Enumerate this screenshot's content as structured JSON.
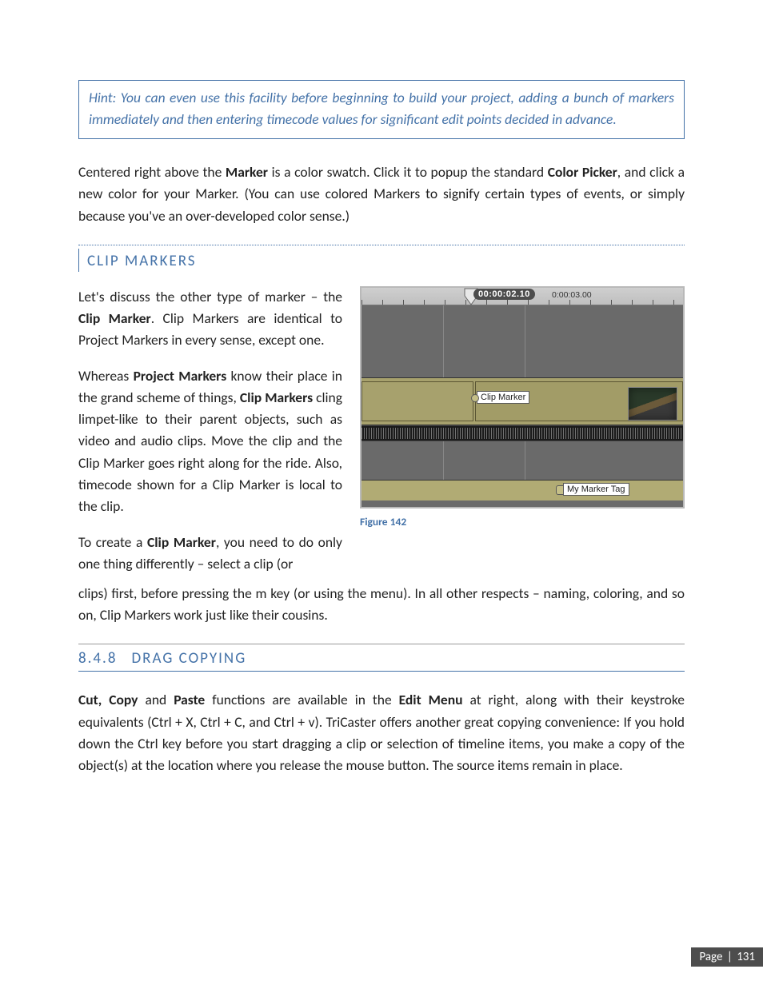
{
  "hint": "Hint: You can even use this facility before beginning to build your project, adding a bunch of markers immediately and then entering timecode values for significant edit points decided in advance.",
  "para_color": {
    "seg1": "Centered right above the ",
    "marker": "Marker",
    "seg2": " is a color swatch.  Click it to popup the standard ",
    "picker": "Color Picker",
    "seg3": ", and click a new color for your Marker.  (You can use colored Markers to signify certain types of events, or simply because you've an over-developed color sense.)"
  },
  "clip_heading": "CLIP MARKERS",
  "clip_p1": {
    "seg1": "Let's discuss the other type of marker – the ",
    "b1": "Clip Marker",
    "seg2": ". Clip Markers are identical to Project Markers in every sense, except one."
  },
  "clip_p2": {
    "seg1": "Whereas ",
    "b1": "Project Markers",
    "seg2": " know their place in the grand scheme of things, ",
    "b2": "Clip Markers",
    "seg3": " cling limpet-like to their parent objects, such as video and audio clips. Move the clip and the Clip Marker goes right along for the ride. Also, timecode shown for a Clip Marker is local to the clip."
  },
  "clip_p3": {
    "seg1": "To create a ",
    "b1": "Clip Marker",
    "seg2": ", you need to do only one thing differently – select a clip (or"
  },
  "clip_p4": "clips) first, before pressing the m key (or using the menu). In all other respects – naming, coloring, and so on, Clip Markers work just like their cousins.",
  "figure": {
    "timecode_badge": "00:00:02.10",
    "timecode_small": "0:00:03.00",
    "clip_marker_label": "Clip Marker",
    "marker_tag_label": "My Marker Tag",
    "caption": "Figure 142"
  },
  "drag": {
    "num": "8.4.8",
    "title": "DRAG COPYING",
    "para": {
      "b1": "Cut, Copy",
      "seg1": " and ",
      "b2": "Paste",
      "seg2": " functions are available in the ",
      "b3": "Edit Menu",
      "seg3": " at right, along with their keystroke equivalents (Ctrl + X, Ctrl + C, and Ctrl + v). TriCaster offers another great copying convenience: If you hold down the Ctrl key before you start dragging a clip or selection of timeline items, you make a copy of the object(s) at the location where you release the mouse button. The source items remain in place."
    }
  },
  "footer": {
    "label": "Page",
    "sep": "|",
    "num": "131"
  }
}
